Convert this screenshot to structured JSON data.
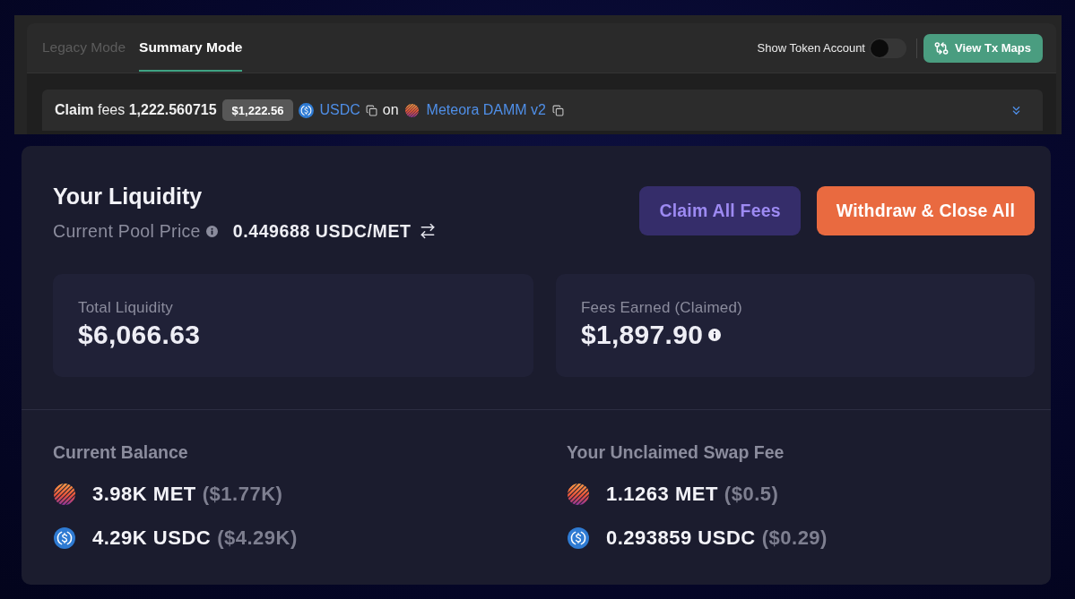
{
  "tabs": [
    {
      "label": "Legacy Mode",
      "selected": false
    },
    {
      "label": "Summary Mode",
      "selected": true
    }
  ],
  "token_account_toggle": {
    "label": "Show Token Account",
    "on": false
  },
  "view_tx_maps": {
    "label": "View Tx Maps"
  },
  "claim_row": {
    "summary": "**Claim** fees **1,222.560715**",
    "usd_value": "$1,222.56",
    "token": "USDC",
    "connector": "on",
    "protocol": "Meteora DAMM v2"
  },
  "liquidity": {
    "title": "Your Liquidity",
    "price_label": "Current Pool Price",
    "price_value": "0.449688 USDC/MET",
    "buttons": [
      {
        "label": "Claim All Fees",
        "kind": "secondary"
      },
      {
        "label": "Withdraw & Close All",
        "kind": "primary"
      }
    ],
    "stats": [
      {
        "label": "Total Liquidity",
        "value": "$6,066.63",
        "info": false
      },
      {
        "label": "Fees Earned (Claimed)",
        "value": "$1,897.90",
        "info": true
      }
    ],
    "sections": [
      {
        "title": "Current Balance",
        "tokens": [
          {
            "kind": "met",
            "amount": "3.98K MET",
            "usd": "($1.77K)"
          },
          {
            "kind": "usdc",
            "amount": "4.29K USDC",
            "usd": "($4.29K)"
          }
        ]
      },
      {
        "title": "Your Unclaimed Swap Fee",
        "tokens": [
          {
            "kind": "met",
            "amount": "1.1263 MET",
            "usd": "($0.5)"
          },
          {
            "kind": "usdc",
            "amount": "0.293859 USDC",
            "usd": "($0.29)"
          }
        ]
      }
    ]
  }
}
